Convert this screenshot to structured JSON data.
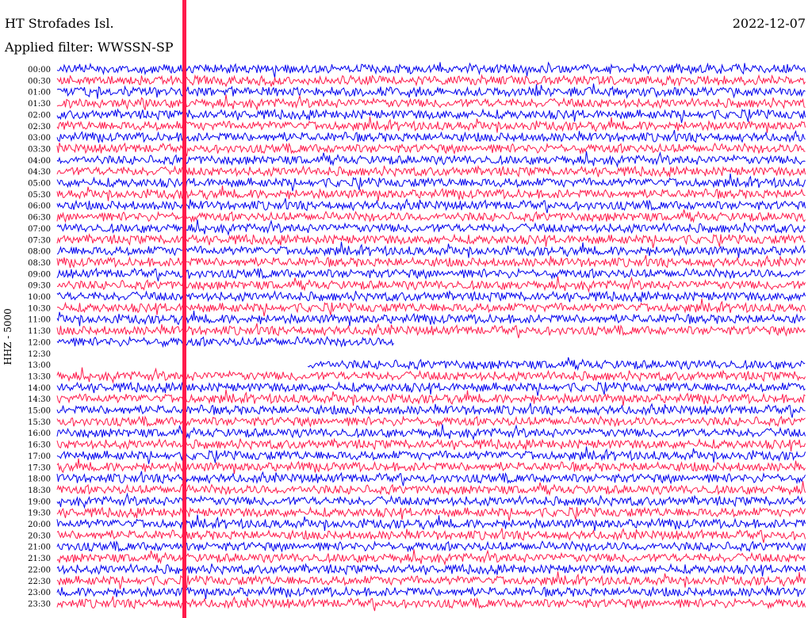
{
  "header": {
    "station": "HT Strofades Isl.",
    "date": "2022-12-07",
    "filter": "Applied filter: WWSSN-SP"
  },
  "chart_data": {
    "type": "line",
    "title": "HT Strofades Isl.",
    "ylabel": "HHZ - 5000",
    "colors": [
      "#0000ee",
      "#ff1a4b"
    ],
    "rows": [
      "00:00",
      "00:30",
      "01:00",
      "01:30",
      "02:00",
      "02:30",
      "03:00",
      "03:30",
      "04:00",
      "04:30",
      "05:00",
      "05:30",
      "06:00",
      "06:30",
      "07:00",
      "07:30",
      "08:00",
      "08:30",
      "09:00",
      "09:30",
      "10:00",
      "10:30",
      "11:00",
      "11:30",
      "12:00",
      "12:30",
      "13:00",
      "13:30",
      "14:00",
      "14:30",
      "15:00",
      "15:30",
      "16:00",
      "16:30",
      "17:00",
      "17:30",
      "18:00",
      "18:30",
      "19:00",
      "19:30",
      "20:00",
      "20:30",
      "21:00",
      "21:30",
      "22:00",
      "22:30",
      "23:00",
      "23:30"
    ],
    "gaps": [
      {
        "row": "12:00",
        "from_fraction": 0.45,
        "to_fraction": 1.0
      },
      {
        "row": "12:30",
        "from_fraction": 0.0,
        "to_fraction": 1.0
      },
      {
        "row": "13:00",
        "from_fraction": 0.0,
        "to_fraction": 0.335
      }
    ]
  }
}
